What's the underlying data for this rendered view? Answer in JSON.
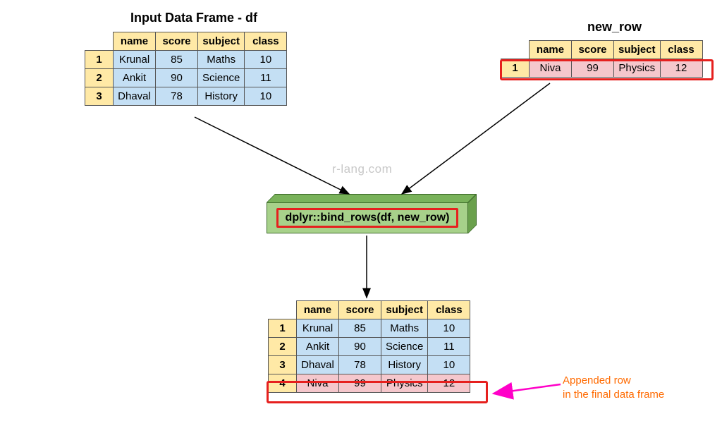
{
  "titles": {
    "df": "Input Data Frame - df",
    "new_row": "new_row"
  },
  "columns": {
    "c0": "name",
    "c1": "score",
    "c2": "subject",
    "c3": "class"
  },
  "df": {
    "r1": {
      "idx": "1",
      "name": "Krunal",
      "score": "85",
      "subject": "Maths",
      "class": "10"
    },
    "r2": {
      "idx": "2",
      "name": "Ankit",
      "score": "90",
      "subject": "Science",
      "class": "11"
    },
    "r3": {
      "idx": "3",
      "name": "Dhaval",
      "score": "78",
      "subject": "History",
      "class": "10"
    }
  },
  "new_row": {
    "r1": {
      "idx": "1",
      "name": "Niva",
      "score": "99",
      "subject": "Physics",
      "class": "12"
    }
  },
  "result": {
    "r1": {
      "idx": "1",
      "name": "Krunal",
      "score": "85",
      "subject": "Maths",
      "class": "10"
    },
    "r2": {
      "idx": "2",
      "name": "Ankit",
      "score": "90",
      "subject": "Science",
      "class": "11"
    },
    "r3": {
      "idx": "3",
      "name": "Dhaval",
      "score": "78",
      "subject": "History",
      "class": "10"
    },
    "r4": {
      "idx": "4",
      "name": "Niva",
      "score": "99",
      "subject": "Physics",
      "class": "12"
    }
  },
  "command": "dplyr::bind_rows(df, new_row)",
  "watermark": "r-lang.com",
  "annotation": {
    "l1": "Appended row",
    "l2": "in the final data frame"
  }
}
